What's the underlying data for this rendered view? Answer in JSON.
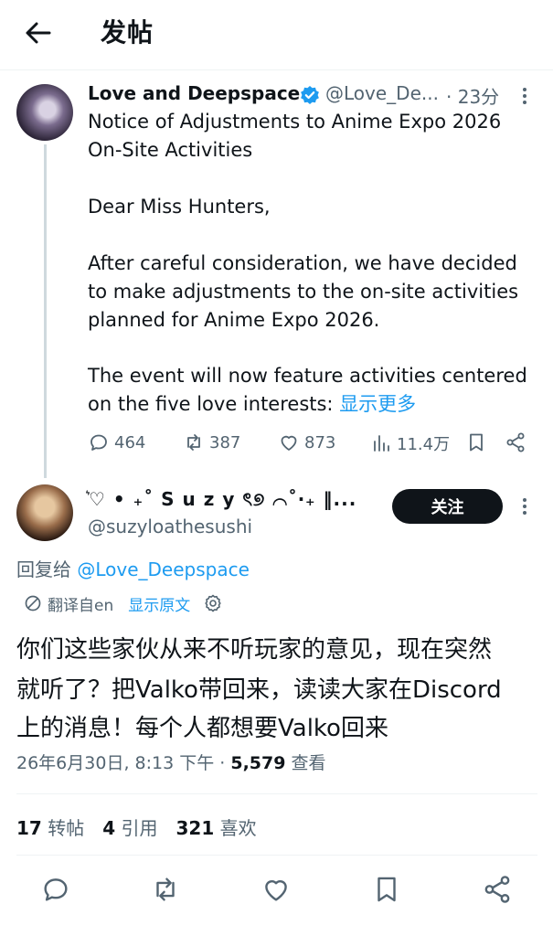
{
  "header": {
    "title": "发帖"
  },
  "parent": {
    "name": "Love and Deepspace",
    "handle": "@Love_De...",
    "time": "· 23分",
    "lines": [
      "Notice of Adjustments to Anime Expo 2026",
      "On-Site Activities",
      "Dear Miss Hunters,",
      "After careful consideration, we have decided",
      "to make adjustments to the on-site activities",
      "planned for Anime Expo 2026.",
      "The event will now feature activities centered",
      "on the five love interests: "
    ],
    "show_more": "显示更多",
    "actions": {
      "replies": "464",
      "reposts": "387",
      "likes": "873",
      "views": "11.4万"
    }
  },
  "reply": {
    "name": "͛♡ • ₊˚ S u z y ৎ୭ ⌒˚‧₊ ‖...",
    "handle": "@suzyloathesushi",
    "follow_label": "关注",
    "replying_prefix": "回复给 ",
    "replying_handle": "@Love_Deepspace",
    "translated_from": "翻译自en",
    "show_original": "显示原文",
    "lines": [
      "你们这些家伙从来不听玩家的意见，现在突然",
      "就听了？把Valko带回来，读读大家在Discord",
      "上的消息！每个人都想要Valko回来"
    ],
    "timestamp": "26年6月30日, 8:13 下午 · ",
    "views_count": "5,579",
    "views_label": " 查看",
    "stats": {
      "reposts_count": "17",
      "reposts_label": "转帖",
      "quotes_count": "4",
      "quotes_label": "引用",
      "likes_count": "321",
      "likes_label": "喜欢"
    }
  },
  "colors": {
    "accent": "#1d9bf0",
    "text": "#0f1419",
    "muted": "#536471"
  },
  "icons": [
    "back-arrow-icon",
    "verified-badge-icon",
    "more-vertical-icon",
    "reply-icon",
    "repost-icon",
    "like-icon",
    "views-icon",
    "bookmark-icon",
    "share-icon",
    "translate-icon",
    "settings-gear-icon"
  ]
}
